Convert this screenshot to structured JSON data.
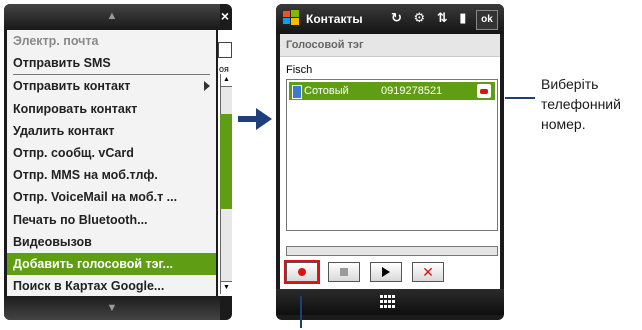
{
  "left_phone": {
    "close_label": "×",
    "scroll_up": "▲",
    "scroll_down": "▼",
    "menu_items": [
      {
        "label": "Электр. почта",
        "state": "disabled"
      },
      {
        "label": "Отправить SMS",
        "state": "normal"
      },
      {
        "label": "Отправить контакт",
        "state": "normal",
        "submenu": true
      },
      {
        "label": "Копировать контакт",
        "state": "normal"
      },
      {
        "label": "Удалить контакт",
        "state": "normal"
      },
      {
        "label": "Отпр. сообщ. vCard",
        "state": "normal"
      },
      {
        "label": "Отпр. MMS на моб.тлф.",
        "state": "normal"
      },
      {
        "label": "Отпр. VoiceMail на моб.т ...",
        "state": "normal"
      },
      {
        "label": "Печать по Bluetooth...",
        "state": "normal"
      },
      {
        "label": "Видеовызов",
        "state": "normal"
      },
      {
        "label": "Добавить голосовой тэг...",
        "state": "highlighted"
      },
      {
        "label": "Поиск в Картах Google...",
        "state": "normal"
      }
    ],
    "background_fragment": "оя"
  },
  "right_phone": {
    "app_title": "Контакты",
    "status_icons": "↻ ⚙ ⇅ ▮ ◁",
    "ok_label": "ok",
    "header": "Голосовой тэг",
    "contact_name": "Fisch",
    "number_row": {
      "type": "Сотовый",
      "number": "0919278521"
    },
    "controls": [
      "record",
      "stop",
      "play",
      "delete"
    ],
    "delete_label": "✕"
  },
  "callout": {
    "text": "Виберіть\nтелефонний\nномер."
  },
  "colors": {
    "highlight": "#5f9e14",
    "callout_line": "#1f3f7a",
    "record_red": "#d11111"
  }
}
